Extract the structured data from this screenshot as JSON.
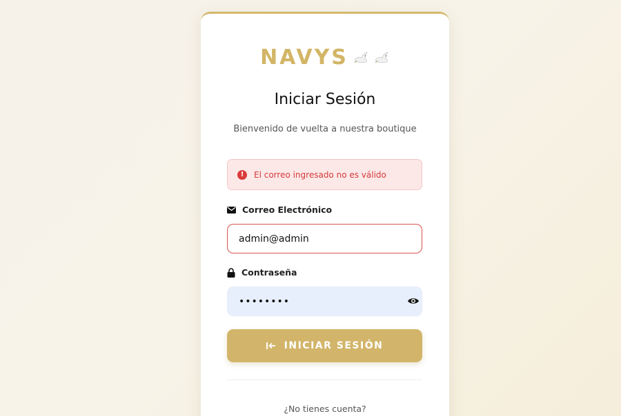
{
  "brand": {
    "name": "NAVYS",
    "icons": [
      "dove-icon",
      "dove-icon"
    ],
    "color": "#d2b566"
  },
  "header": {
    "title": "Iniciar Sesión",
    "subtitle": "Bienvenido de vuelta a nuestra boutique"
  },
  "alert": {
    "icon": "error-icon",
    "message": "El correo ingresado no es válido",
    "color": "#d23a3a"
  },
  "form": {
    "email": {
      "label": "Correo Electrónico",
      "icon": "envelope-icon",
      "value": "admin@admin"
    },
    "password": {
      "label": "Contraseña",
      "icon": "lock-icon",
      "value": "••••••••",
      "toggle_icon": "eye-icon"
    },
    "submit": {
      "label": "INICIAR SESIÓN",
      "icon": "sign-in-icon",
      "color": "#d2b56a"
    }
  },
  "footer": {
    "no_account_text": "¿No tienes cuenta?"
  }
}
